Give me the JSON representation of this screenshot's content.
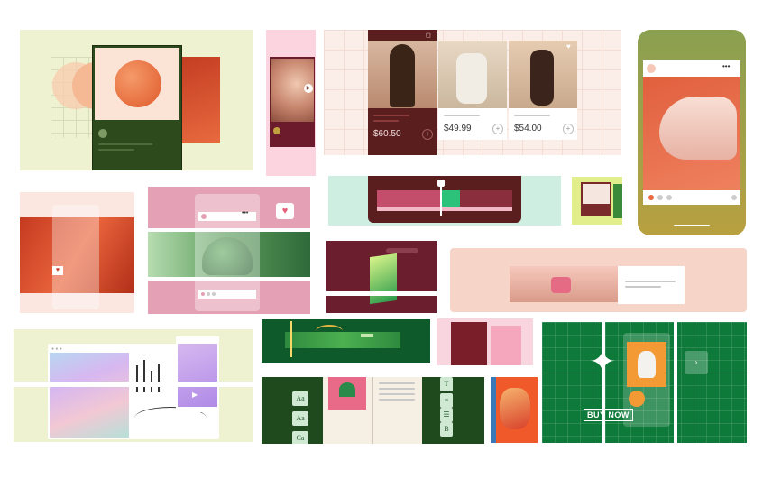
{
  "colors": {
    "cream": "#eef3d2",
    "pink": "#f9d5e0",
    "green_dark": "#2c4a1d",
    "green_brand": "#0e7a3a",
    "maroon": "#5a1e1e",
    "coral": "#e9603c",
    "peach": "#f5d3c7"
  },
  "shop": {
    "products": [
      {
        "price": "$60.50"
      },
      {
        "price": "$49.99"
      },
      {
        "price": "$54.00"
      }
    ]
  },
  "cta": {
    "buy_now": "BUY NOW"
  },
  "editor": {
    "format_buttons": [
      "Aa",
      "Aa",
      "Ca"
    ],
    "toolbar_icons": [
      "T",
      "≡",
      "☰",
      "B"
    ]
  },
  "phone": {
    "menu": "•••"
  },
  "browser": {
    "menu": "•••"
  }
}
